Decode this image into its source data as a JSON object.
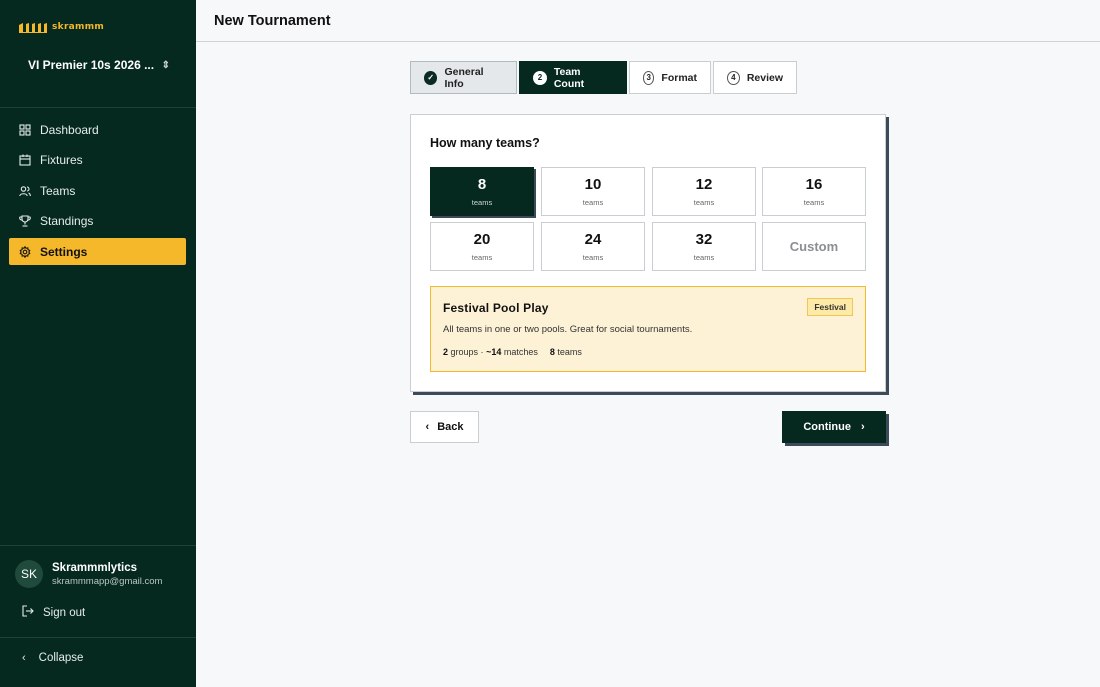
{
  "sidebar": {
    "logo_text": "skrammm",
    "tournament": "VI Premier 10s 2026 ...",
    "nav": [
      {
        "label": "Dashboard",
        "icon": "dashboard-icon"
      },
      {
        "label": "Fixtures",
        "icon": "calendar-icon"
      },
      {
        "label": "Teams",
        "icon": "users-icon"
      },
      {
        "label": "Standings",
        "icon": "trophy-icon"
      },
      {
        "label": "Settings",
        "icon": "gear-icon",
        "active": true
      }
    ],
    "user": {
      "initials": "SK",
      "name": "Skrammmlytics",
      "email": "skrammmapp@gmail.com"
    },
    "sign_out": "Sign out",
    "collapse": "Collapse"
  },
  "header": {
    "title": "New Tournament"
  },
  "stepper": [
    {
      "num": "✓",
      "label": "General Info",
      "state": "done"
    },
    {
      "num": "2",
      "label": "Team Count",
      "state": "current"
    },
    {
      "num": "3",
      "label": "Format",
      "state": "todo"
    },
    {
      "num": "4",
      "label": "Review",
      "state": "todo"
    }
  ],
  "card": {
    "title": "How many teams?",
    "options": [
      {
        "value": "8",
        "unit": "teams",
        "selected": true
      },
      {
        "value": "10",
        "unit": "teams"
      },
      {
        "value": "12",
        "unit": "teams"
      },
      {
        "value": "16",
        "unit": "teams"
      },
      {
        "value": "20",
        "unit": "teams"
      },
      {
        "value": "24",
        "unit": "teams"
      },
      {
        "value": "32",
        "unit": "teams"
      },
      {
        "value": "Custom",
        "unit": ""
      }
    ],
    "format": {
      "name": "Festival Pool Play",
      "badge": "Festival",
      "description": "All teams in one or two pools. Great for social tournaments.",
      "groups_num": "2",
      "groups_text": "groups ·",
      "matches_num": "~14",
      "matches_text": "matches",
      "teams_num": "8",
      "teams_text": "teams"
    }
  },
  "buttons": {
    "back": "Back",
    "continue": "Continue"
  },
  "colors": {
    "sidebar_bg": "#06291f",
    "accent": "#f5b82a",
    "format_bg": "#fdf2d6"
  }
}
